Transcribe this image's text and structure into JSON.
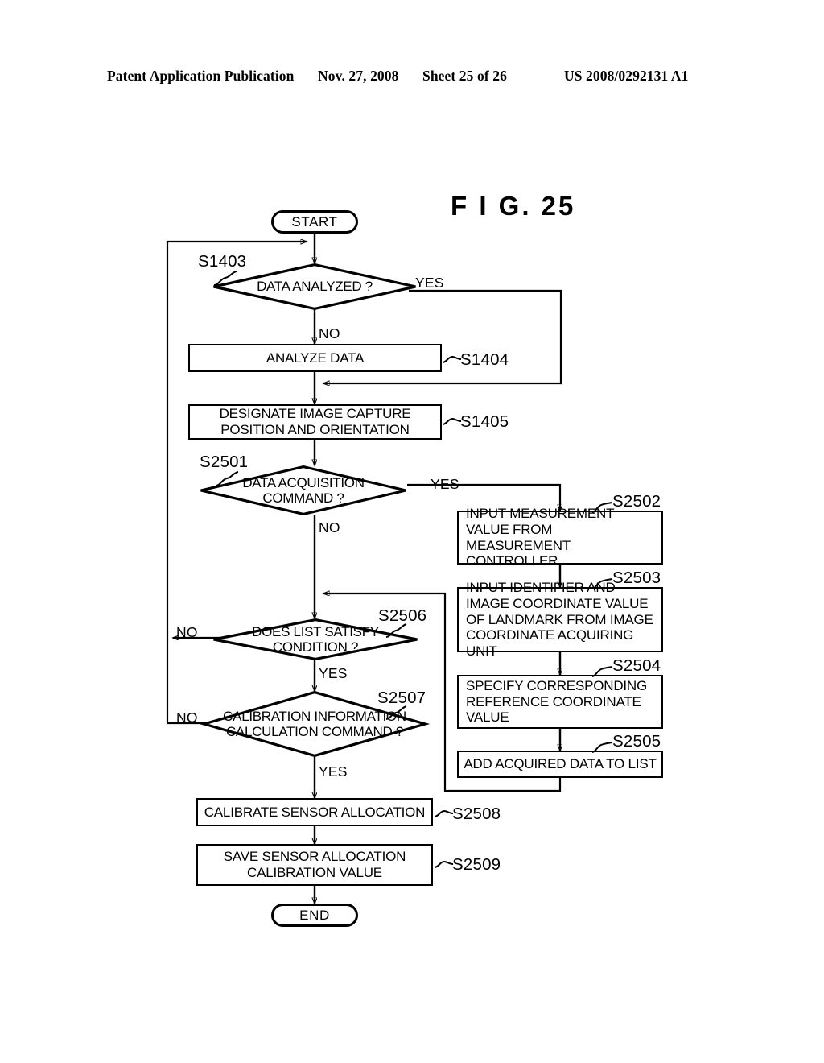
{
  "header": {
    "publication": "Patent Application Publication",
    "date": "Nov. 27, 2008",
    "sheet": "Sheet 25 of 26",
    "patent_number": "US 2008/0292131 A1"
  },
  "figure": {
    "title": "F I G.  25"
  },
  "flowchart": {
    "start": {
      "label": "START"
    },
    "end": {
      "label": "END"
    },
    "nodes": {
      "s1403": {
        "step": "S1403",
        "text": "DATA ANALYZED ?",
        "type": "decision"
      },
      "s1404": {
        "step": "S1404",
        "text": "ANALYZE DATA",
        "type": "process"
      },
      "s1405": {
        "step": "S1405",
        "text": "DESIGNATE IMAGE CAPTURE POSITION AND ORIENTATION",
        "type": "process"
      },
      "s2501": {
        "step": "S2501",
        "text": "DATA ACQUISITION COMMAND ?",
        "type": "decision"
      },
      "s2502": {
        "step": "S2502",
        "text": "INPUT MEASUREMENT VALUE FROM MEASUREMENT CONTROLLER",
        "type": "process"
      },
      "s2503": {
        "step": "S2503",
        "text": "INPUT IDENTIFIER AND IMAGE COORDINATE VALUE OF LANDMARK FROM IMAGE COORDINATE ACQUIRING UNIT",
        "type": "process"
      },
      "s2504": {
        "step": "S2504",
        "text": "SPECIFY CORRESPONDING REFERENCE COORDINATE VALUE",
        "type": "process"
      },
      "s2505": {
        "step": "S2505",
        "text": "ADD ACQUIRED DATA TO LIST",
        "type": "process"
      },
      "s2506": {
        "step": "S2506",
        "text": "DOES LIST SATISFY CONDITION ?",
        "type": "decision"
      },
      "s2507": {
        "step": "S2507",
        "text": "CALIBRATION INFORMATION CALCULATION COMMAND ?",
        "type": "decision"
      },
      "s2508": {
        "step": "S2508",
        "text": "CALIBRATE SENSOR ALLOCATION",
        "type": "process"
      },
      "s2509": {
        "step": "S2509",
        "text": "SAVE SENSOR ALLOCATION CALIBRATION VALUE",
        "type": "process"
      }
    },
    "branches": {
      "s1403_yes": "YES",
      "s1403_no": "NO",
      "s2501_yes": "YES",
      "s2501_no": "NO",
      "s2506_no": "NO",
      "s2506_yes": "YES",
      "s2507_no": "NO",
      "s2507_yes": "YES"
    }
  },
  "colors": {
    "ink": "#000000",
    "paper": "#ffffff"
  }
}
